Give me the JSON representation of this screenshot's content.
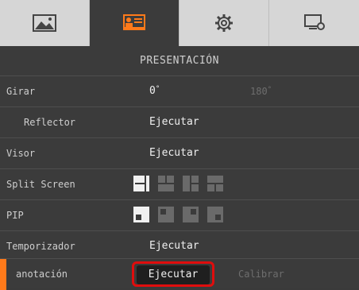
{
  "tabs": [
    {
      "icon": "image-icon",
      "active": false
    },
    {
      "icon": "presentation-icon",
      "active": true
    },
    {
      "icon": "gear-icon",
      "active": false
    },
    {
      "icon": "monitor-settings-icon",
      "active": false
    }
  ],
  "section_title": "PRESENTACIÓN",
  "rows": {
    "girar": {
      "label": "Girar",
      "value_on": "0",
      "value_off": "180",
      "degree_symbol": "°"
    },
    "reflector": {
      "label": "Reflector",
      "action": "Ejecutar"
    },
    "visor": {
      "label": "Visor",
      "action": "Ejecutar"
    },
    "split": {
      "label": "Split Screen",
      "options": [
        "split-layout-1-icon",
        "split-layout-2-icon",
        "split-layout-3-icon",
        "split-layout-4-icon"
      ]
    },
    "pip": {
      "label": "PIP",
      "options": [
        "pip-layout-1-icon",
        "pip-layout-2-icon",
        "pip-layout-3-icon",
        "pip-layout-4-icon"
      ]
    },
    "temporizador": {
      "label": "Temporizador",
      "action": "Ejecutar"
    },
    "anotacion": {
      "label": "anotación",
      "action": "Ejecutar",
      "secondary": "Calibrar"
    }
  },
  "colors": {
    "accent": "#ff7a1a",
    "highlight_ring": "#e00d0d"
  }
}
